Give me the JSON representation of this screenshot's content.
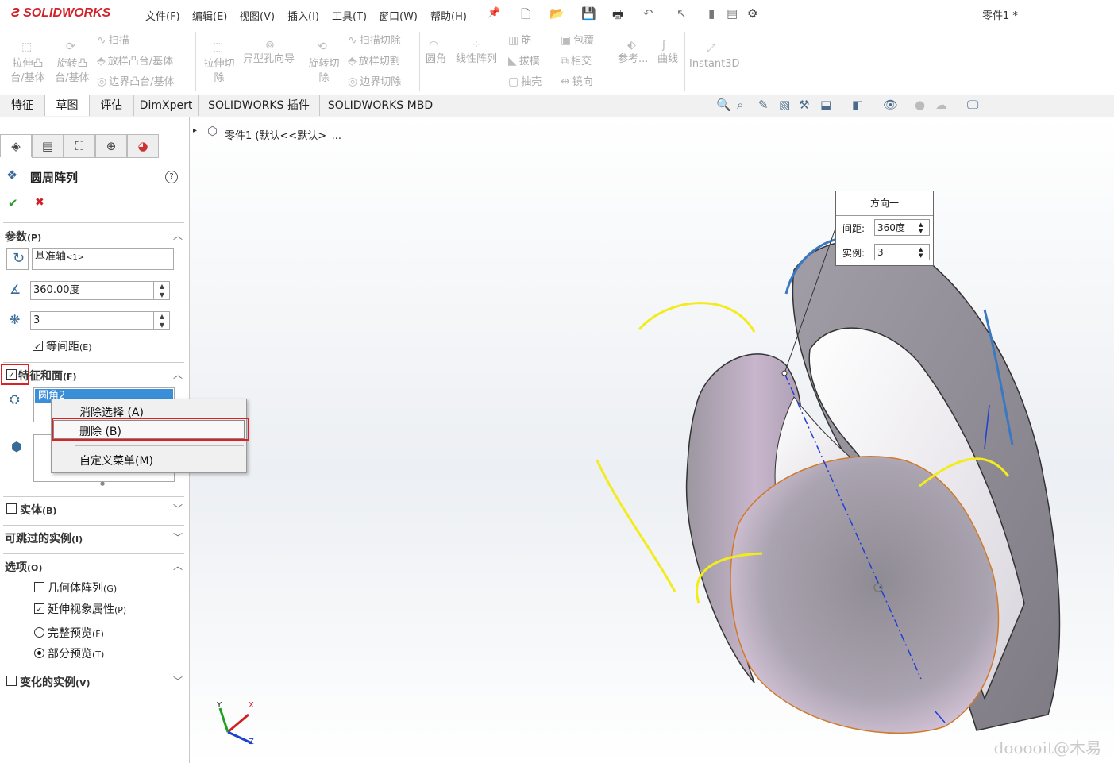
{
  "app": {
    "logo_mark": "ƨ",
    "logo_text": "SOLIDWORKS",
    "document_title": "零件1 *",
    "menu": [
      "文件(F)",
      "编辑(E)",
      "视图(V)",
      "插入(I)",
      "工具(T)",
      "窗口(W)",
      "帮助(H)"
    ]
  },
  "ribbon": {
    "extrude_boss": [
      "拉伸凸",
      "台/基体"
    ],
    "revolve_boss": [
      "旋转凸",
      "台/基体"
    ],
    "sweep": "扫描",
    "loft_boss": "放样凸台/基体",
    "boundary_boss": "边界凸台/基体",
    "extrude_cut": [
      "拉伸切",
      "除"
    ],
    "hole_wizard": "异型孔向导",
    "revolve_cut": [
      "旋转切",
      "除"
    ],
    "swept_cut": "扫描切除",
    "lofted_cut": "放样切割",
    "boundary_cut": "边界切除",
    "fillet": "圆角",
    "linear_pattern": "线性阵列",
    "rib": "筋",
    "draft": "拔模",
    "shell": "抽壳",
    "wrap": "包覆",
    "intersect": "相交",
    "mirror": "镜向",
    "reference": "参考...",
    "curves": "曲线",
    "instant3d": "Instant3D"
  },
  "tabs": [
    "特征",
    "草图",
    "评估",
    "DimXpert",
    "SOLIDWORKS 插件",
    "SOLIDWORKS MBD"
  ],
  "panel": {
    "title": "圆周阵列",
    "help": "?",
    "ok": "✔",
    "cancel": "✖",
    "params_section": "参数",
    "params_key": "(P)",
    "axis_value": "基准轴",
    "axis_suffix": "<1>",
    "angle_value": "360.00度",
    "instances_value": "3",
    "equal_spacing": "等间距",
    "equal_spacing_key": "(E)",
    "features_section": "特征和面",
    "features_key": "(F)",
    "feature_item": "圆角2",
    "bodies_section": "实体",
    "bodies_key": "(B)",
    "skip_section": "可跳过的实例",
    "skip_key": "(I)",
    "options_section": "选项",
    "options_key": "(O)",
    "geometry_pattern": "几何体阵列",
    "geometry_key": "(G)",
    "propagate": "延伸视象属性",
    "propagate_key": "(P)",
    "full_preview": "完整预览",
    "full_key": "(F)",
    "partial_preview": "部分预览",
    "partial_key": "(T)",
    "vary_section": "变化的实例",
    "vary_key": "(V)"
  },
  "context_menu": {
    "clear_selection": "消除选择 (A)",
    "delete": "删除 (B)",
    "customize": "自定义菜单(M)"
  },
  "viewport": {
    "tree_label": "零件1  (默认<<默认>_...",
    "popup_title": "方向一",
    "spacing_label": "间距:",
    "spacing_value": "360度",
    "instances_label": "实例:",
    "instances_value": "3",
    "axis_x": "X",
    "axis_y": "Y",
    "axis_z": "Z",
    "watermark": "dooooit@木易"
  },
  "colors": {
    "accent": "#d2232a",
    "highlight_red": "#e02020",
    "selection_blue": "#3b8fd9",
    "preview_yellow": "#f2ec1d",
    "model_gray": "#8e8a92",
    "model_violet": "#c9b4cc"
  }
}
